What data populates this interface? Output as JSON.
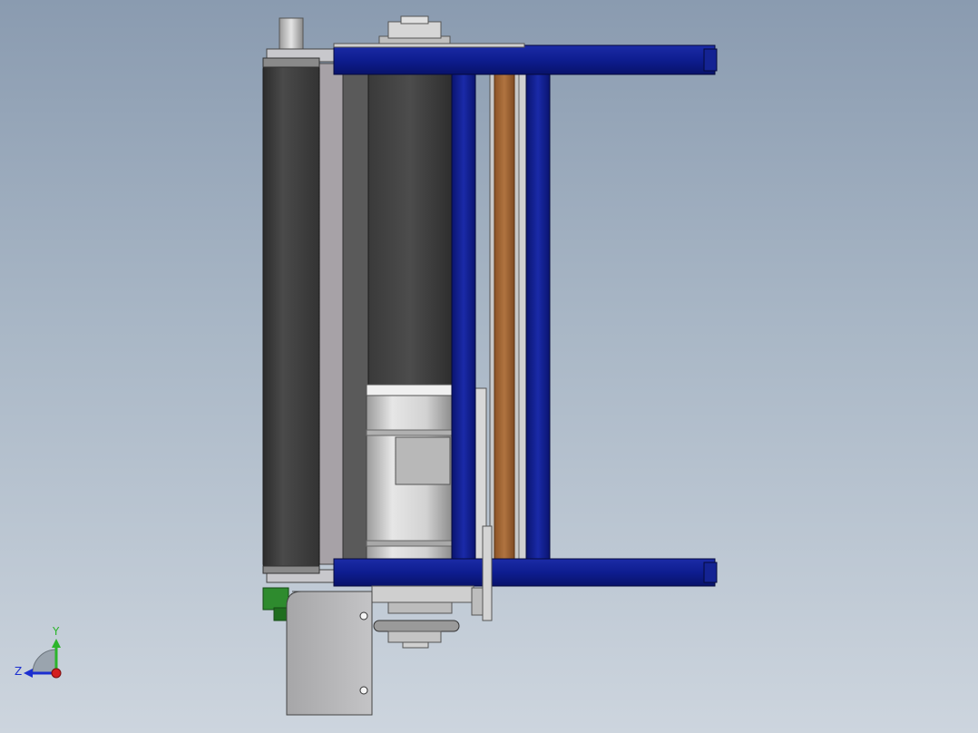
{
  "viewport": {
    "background_top": "#8a9bb0",
    "background_bottom": "#cdd5de"
  },
  "model": {
    "frame_color": "#0f1f8c",
    "roller_color": "#3c3c3c",
    "belt_color": "#a86a3a",
    "motor_color": "#c9c9c9",
    "bracket_color": "#2e8b2e"
  },
  "triad": {
    "y_label": "Y",
    "z_label": "Z",
    "y_color": "#2bb52b",
    "z_color": "#1c2fd0",
    "x_color": "#d41f1f"
  }
}
